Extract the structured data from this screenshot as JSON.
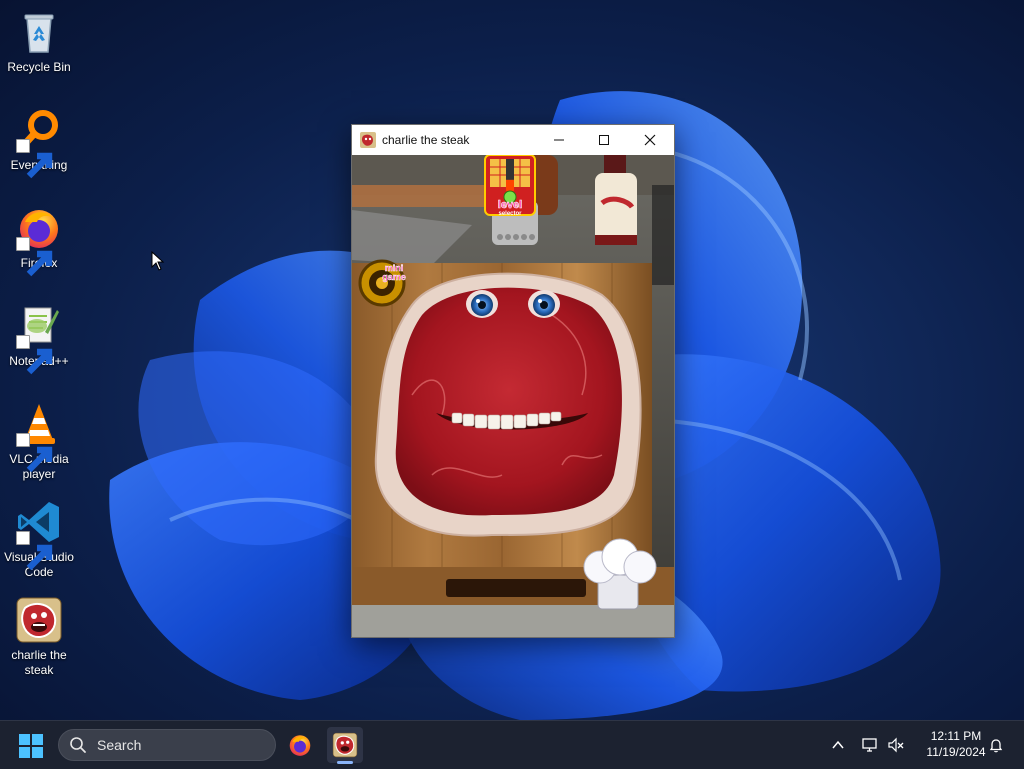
{
  "desktop": {
    "icons": [
      {
        "label": "Recycle Bin",
        "icon": "recycle-bin-icon"
      },
      {
        "label": "Everything",
        "icon": "everything-search-icon"
      },
      {
        "label": "Firefox",
        "icon": "firefox-icon"
      },
      {
        "label": "Notepad++",
        "icon": "notepad-plus-plus-icon"
      },
      {
        "label": "VLC media player",
        "icon": "vlc-icon"
      },
      {
        "label": "Visual Studio Code",
        "icon": "vscode-icon"
      },
      {
        "label": "charlie the steak",
        "icon": "charlie-steak-icon"
      }
    ]
  },
  "window": {
    "title": "charlie the steak",
    "game": {
      "level_badge_text": "level",
      "level_badge_subtext": "selector",
      "mini_game_text_1": "mini",
      "mini_game_text_2": "game",
      "level_meter_fill": 0.35
    }
  },
  "taskbar": {
    "search_placeholder": "Search",
    "clock_time": "12:11 PM",
    "clock_date": "11/19/2024"
  },
  "colors": {
    "accent": "#8ab4f8",
    "taskbar_bg": "#1c2230",
    "steak_red": "#b3202a"
  }
}
